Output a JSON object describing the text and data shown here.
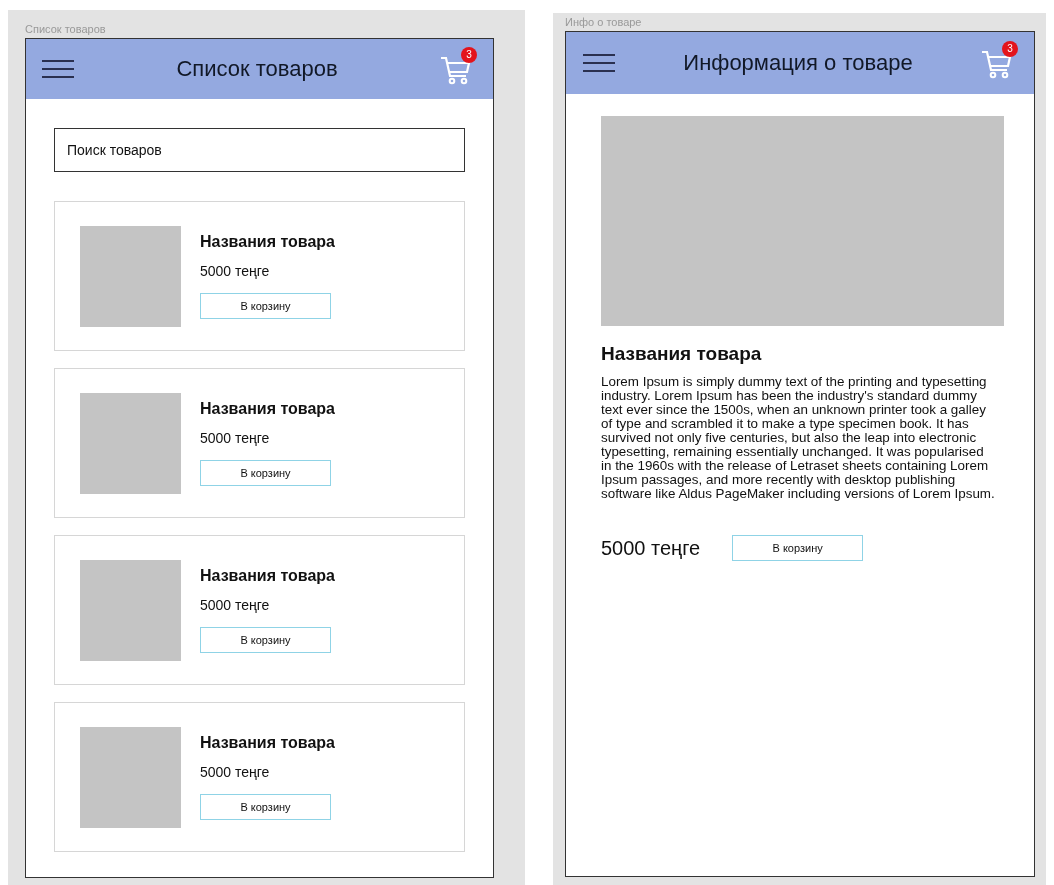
{
  "list_screen": {
    "frame_label": "Список товаров",
    "title": "Список товаров",
    "cart_count": "3",
    "search": {
      "placeholder": "Поиск товаров"
    },
    "products": [
      {
        "name": "Названия товара",
        "price": "5000 теңге",
        "button": "В корзину"
      },
      {
        "name": "Названия товара",
        "price": "5000 теңге",
        "button": "В корзину"
      },
      {
        "name": "Названия товара",
        "price": "5000 теңге",
        "button": "В корзину"
      },
      {
        "name": "Названия товара",
        "price": "5000 теңге",
        "button": "В корзину"
      }
    ]
  },
  "detail_screen": {
    "frame_label": "Инфо о товаре",
    "title": "Информация о товаре",
    "cart_count": "3",
    "name": "Названия товара",
    "description": "Lorem Ipsum is simply dummy text of the printing and typesetting industry. Lorem Ipsum has been the industry's standard dummy text ever since the 1500s, when an unknown printer took a galley of type and scrambled it to make a type specimen book. It has survived not only five centuries, but also the leap into electronic typesetting, remaining essentially unchanged. It was popularised in the 1960s with the release of Letraset sheets containing Lorem Ipsum passages, and more recently with desktop publishing software like Aldus PageMaker including versions of Lorem Ipsum.",
    "price": "5000 теңге",
    "button": "В корзину"
  }
}
